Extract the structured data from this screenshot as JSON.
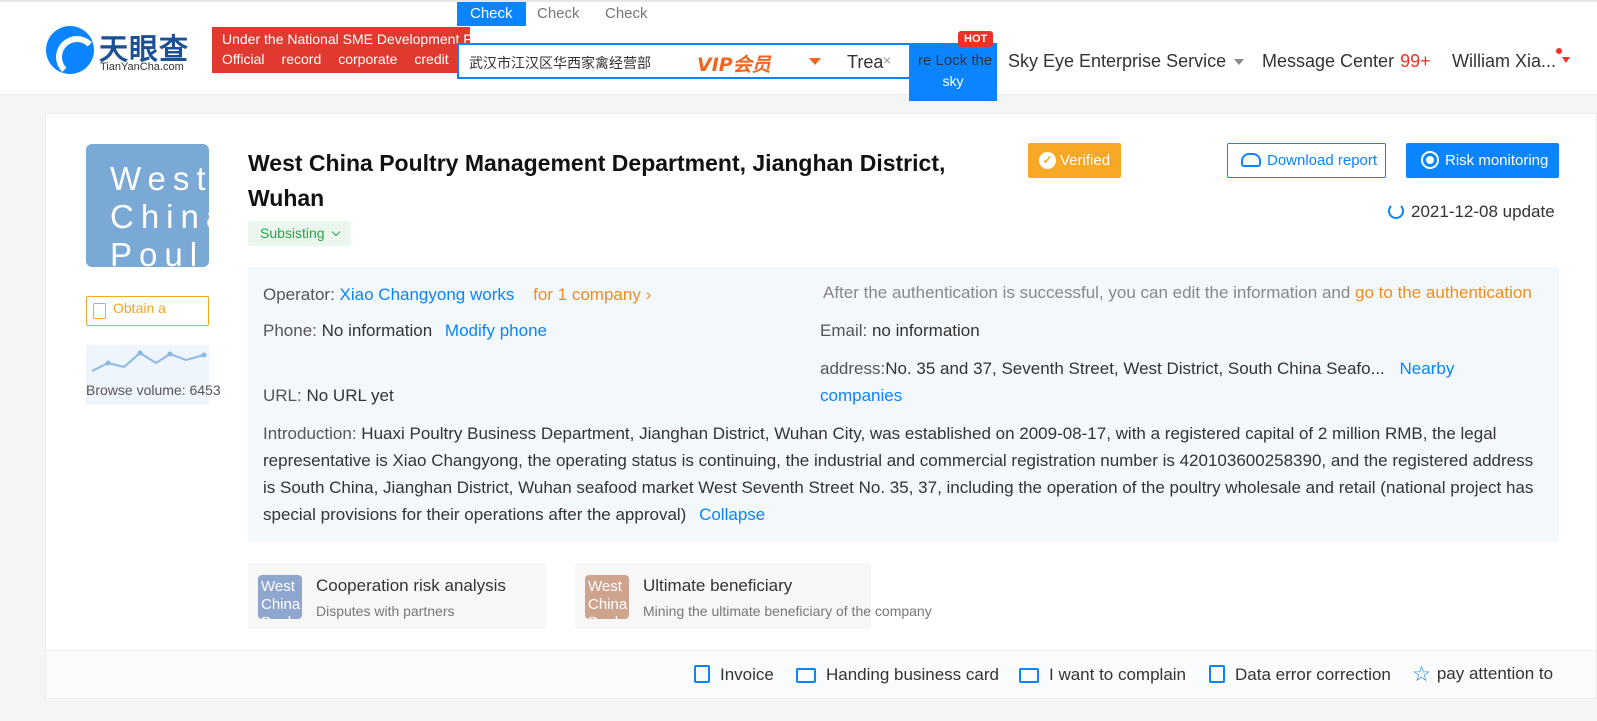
{
  "header": {
    "logo_cn": "天眼查",
    "logo_en": "TianYanCha.com",
    "banner_line1": "Under the National SME Development Fund",
    "banner_line2": [
      "Official",
      "record",
      "corporate",
      "credit"
    ],
    "search_tabs": [
      "Check",
      "Check",
      "Check"
    ],
    "search_query": "武汉市江汉区华西家禽经营部",
    "vip_label": "VIP会员",
    "trea_label": "Trea",
    "clear_icon": "×",
    "lock_label": "re Lock the",
    "search_button_label": "sky",
    "hot_badge": "HOT",
    "nav": {
      "enterprise_service": "Sky Eye Enterprise Service",
      "message_center": "Message Center",
      "message_count": "99+",
      "user": "William Xia..."
    }
  },
  "company": {
    "avatar_text": "West China Poul",
    "name": "West China Poultry Management Department, Jianghan District, Wuhan",
    "verified_label": "Verified",
    "status": "Subsisting",
    "certificate_label": "Obtain a certificate",
    "browse_label": "Browse volume: 6453",
    "download_label": "Download report",
    "monitor_label": "Risk monitoring",
    "update_date": "2021-12-08 update"
  },
  "info": {
    "operator_label": "Operator:",
    "operator_name": "Xiao Changyong works",
    "operator_companies": "for 1 company",
    "auth_notice": "After the authentication is successful, you can edit the information and",
    "auth_link": "go to the authentication",
    "phone_label": "Phone:",
    "phone_value": "No information",
    "modify_phone": "Modify phone",
    "email_label": "Email:",
    "email_value": "no information",
    "address_label": "address:",
    "address_value": "No. 35 and 37, Seventh Street, West District, South China Seafo...",
    "nearby_1": "Nearby",
    "nearby_2": "companies",
    "url_label": "URL:",
    "url_value": "No URL yet",
    "intro_label": "Introduction:",
    "intro_text": "Huaxi Poultry Business Department, Jianghan District, Wuhan City, was established on 2009-08-17, with a registered capital of 2 million RMB, the legal representative is Xiao Changyong, the operating status is continuing, the industrial and commercial registration number is 420103600258390, and the registered address is South China, Jianghan District, Wuhan seafood market West Seventh Street No. 35, 37, including the operation of the poultry wholesale and retail (national project has special provisions for their operations after the approval)",
    "collapse": "Collapse"
  },
  "tiles": [
    {
      "img_text": "West China Poul",
      "title": "Cooperation risk analysis",
      "subtitle": "Disputes with partners",
      "color": "#8fa6cf"
    },
    {
      "img_text": "West China Poul",
      "title": "Ultimate beneficiary",
      "subtitle": "Mining the ultimate beneficiary of the company",
      "color": "#cfa48f"
    }
  ],
  "footer_actions": [
    "Invoice",
    "Handing business card",
    "I want to complain",
    "Data error correction",
    "pay attention to"
  ],
  "colors": {
    "primary": "#0a84ff",
    "verified": "#f7a826",
    "banner": "#e03a30",
    "status": "#28a448"
  }
}
